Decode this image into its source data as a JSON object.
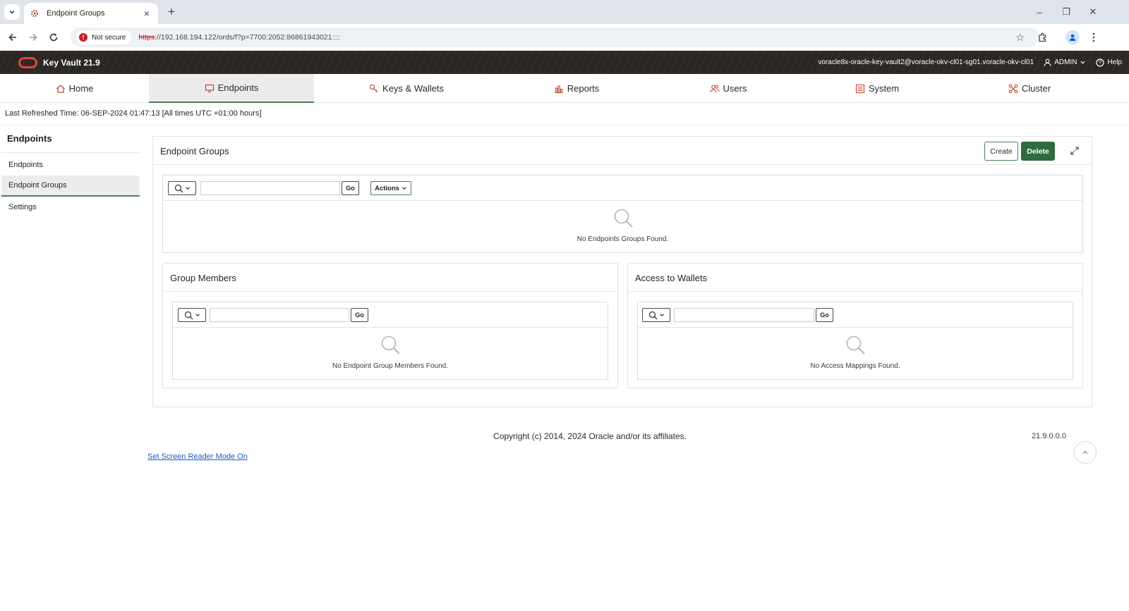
{
  "browser": {
    "tab_title": "Endpoint Groups",
    "new_tab": "+",
    "not_secure": "Not secure",
    "url_scheme": "https",
    "url_rest": "://192.168.194.122/ords/f?p=7700:2052:86861943021::::"
  },
  "header": {
    "app_title": "Key Vault 21.9",
    "host": "voracle8x-oracle-key-vault2@voracle-okv-cl01-sg01.voracle-okv-cl01",
    "user": "ADMIN",
    "help": "Help"
  },
  "nav": {
    "tabs": [
      {
        "label": "Home",
        "icon": "home-icon"
      },
      {
        "label": "Endpoints",
        "icon": "monitor-icon",
        "active": true
      },
      {
        "label": "Keys & Wallets",
        "icon": "key-icon"
      },
      {
        "label": "Reports",
        "icon": "bar-chart-icon"
      },
      {
        "label": "Users",
        "icon": "users-icon"
      },
      {
        "label": "System",
        "icon": "list-icon"
      },
      {
        "label": "Cluster",
        "icon": "cluster-icon"
      }
    ]
  },
  "refresh_text": "Last Refreshed Time: 06-SEP-2024 01:47:13 [All times UTC +01:00 hours]",
  "sidebar": {
    "title": "Endpoints",
    "items": [
      {
        "label": "Endpoints"
      },
      {
        "label": "Endpoint Groups",
        "active": true
      },
      {
        "label": "Settings"
      }
    ]
  },
  "groups_region": {
    "title": "Endpoint Groups",
    "create_label": "Create",
    "delete_label": "Delete",
    "go_label": "Go",
    "actions_label": "Actions",
    "empty_message": "No Endpoints Groups Found."
  },
  "members_region": {
    "title": "Group Members",
    "go_label": "Go",
    "empty_message": "No Endpoint Group Members Found."
  },
  "wallets_region": {
    "title": "Access to Wallets",
    "go_label": "Go",
    "empty_message": "No Access Mappings Found."
  },
  "footer": {
    "copyright": "Copyright (c) 2014, 2024 Oracle and/or its affiliates.",
    "version": "21.9.0.0.0",
    "screen_reader_link": "Set Screen Reader Mode On"
  },
  "colors": {
    "accent_green": "#4f7f59",
    "delete_green": "#2e6b3f",
    "header_bg": "#2b2724",
    "nav_icon_red": "#c74634"
  }
}
